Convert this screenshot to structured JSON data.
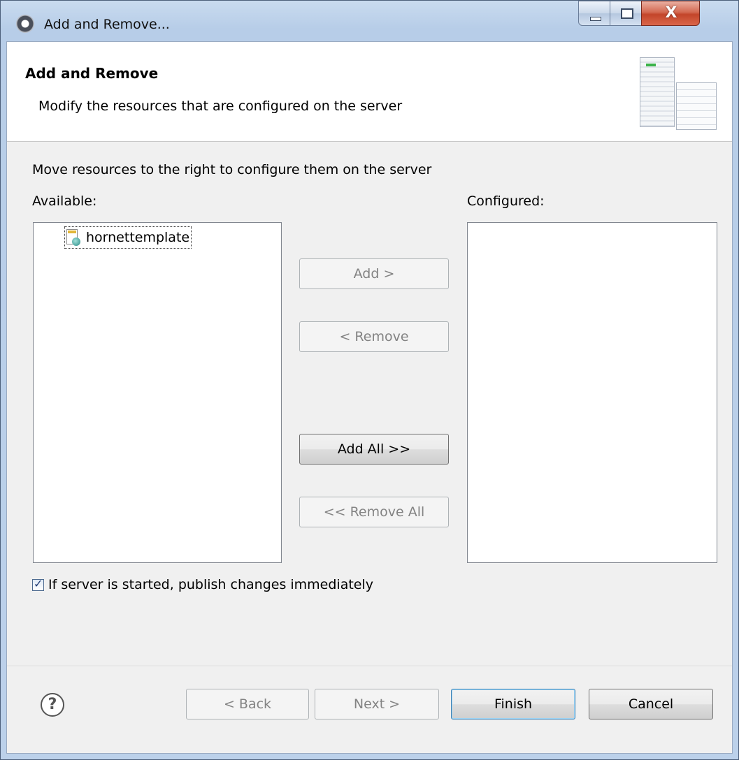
{
  "window": {
    "title": "Add and Remove...",
    "close_glyph": "X"
  },
  "header": {
    "title": "Add and Remove",
    "description": "Modify the resources that are configured on the server"
  },
  "main": {
    "instruction": "Move resources to the right to configure them on the server",
    "available_label": "Available:",
    "configured_label": "Configured:",
    "available_items": [
      {
        "label": "hornettemplate",
        "icon": "web-project-icon"
      }
    ],
    "configured_items": []
  },
  "buttons": {
    "add": "Add >",
    "remove": "< Remove",
    "add_all": "Add All >>",
    "remove_all": "<< Remove All"
  },
  "options": {
    "publish_immediately": {
      "label": "If server is started, publish changes immediately",
      "checked": true
    }
  },
  "footer": {
    "help_glyph": "?",
    "back": "< Back",
    "next": "Next >",
    "finish": "Finish",
    "cancel": "Cancel"
  }
}
